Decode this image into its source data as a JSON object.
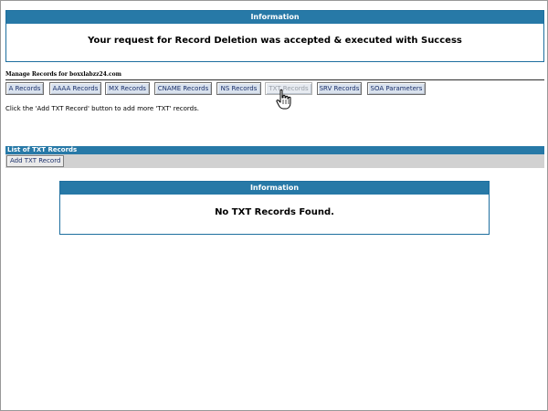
{
  "top_info": {
    "header": "Information",
    "message": "Your request for Record Deletion was accepted & executed with Success"
  },
  "manage": {
    "title": "Manage Records for boxxlabzz24.com",
    "tabs": [
      {
        "label": "A Records"
      },
      {
        "label": "AAAA Records"
      },
      {
        "label": "MX Records"
      },
      {
        "label": "CNAME Records"
      },
      {
        "label": "NS Records"
      },
      {
        "label": "TXT Records",
        "active": true
      },
      {
        "label": "SRV Records"
      },
      {
        "label": "SOA Parameters"
      }
    ],
    "hint": "Click the 'Add TXT Record' button to add more 'TXT' records."
  },
  "list": {
    "title": "List of TXT Records",
    "add_button": "Add TXT Record"
  },
  "bottom_info": {
    "header": "Information",
    "message": "No TXT Records Found."
  },
  "colors": {
    "header_blue": "#2779a7",
    "tab_bg": "#d9e2ee",
    "toolbar_gray": "#d1d1d1"
  },
  "icons": {
    "cursor": "hand-pointer-icon"
  }
}
